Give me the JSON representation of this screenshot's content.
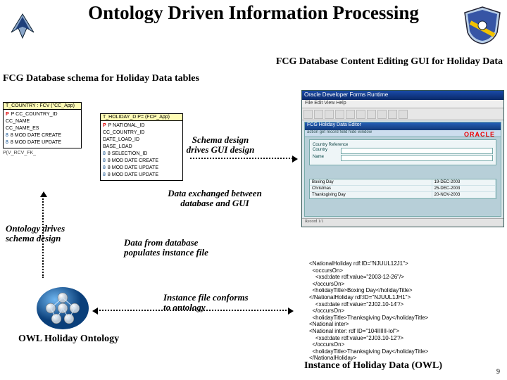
{
  "title": "Ontology Driven Information Processing",
  "labels": {
    "top_right": "FCG Database Content Editing GUI for Holiday Data",
    "top_left": "FCG Database schema for Holiday Data tables",
    "owl": "OWL Holiday Ontology",
    "bottom_right": "Instance of Holiday Data (OWL)"
  },
  "annotations": {
    "schema_to_gui": "Schema design\ndrives GUI design",
    "db_gui": "Data exchanged between\ndatabase and GUI",
    "ont_schema": "Ontology drives\nschema design",
    "db_to_instance": "Data from database\npopulates instance file",
    "instance_to_ont": "Instance file conforms\nto ontology"
  },
  "schema": {
    "table1": {
      "head": "T_COUNTRY : FCV (\"CC_App)",
      "rows": [
        "P  CC_COUNTRY_ID",
        "   CC_NAME",
        "   CC_NAME_ES",
        "8  MOD DATE CREATE",
        "8  MOD DATE UPDATE"
      ]
    },
    "table2": {
      "head": "T_HOLIDAY_D  P= (FCP_App)",
      "rows": [
        "P  NATIONAL_ID",
        "   CC_COUNTRY_ID",
        "   DATE_LOAD_ID",
        "   BASE_LOAD",
        "8  SELECTION_ID",
        "8  MOD DATE CREATE",
        "8  MOD DATE UPDATE",
        "8  MOD DATE UPDATE"
      ]
    },
    "rel": "P(V_RCV_FK_"
  },
  "gui": {
    "title": "Oracle Developer Forms Runtime",
    "menubar": "File  Edit  View  Help",
    "subbar": "FCG Holiday Data Editor",
    "menu2": "action  get  record  field  hide  window",
    "brand": "ORACLE",
    "form_caption": "Country Reference",
    "fields": [
      {
        "label": "Country",
        "value": ""
      },
      {
        "label": "Name",
        "value": ""
      }
    ],
    "rows": [
      {
        "c1": "Boxing Day",
        "c2": "19-DEC-2003"
      },
      {
        "c1": "Christmas",
        "c2": "25-DEC-2003"
      },
      {
        "c1": "Thanksgiving Day",
        "c2": "20-NOV-2003"
      }
    ],
    "status": "Record 1/1"
  },
  "xml_lines": [
    "<NationalHoliday rdf:ID=\"NJUUL12J1\">",
    "  <occursOn>",
    "    <xsd:date rdf:value=\"2003-12-26\"/>",
    "  </occursOn>",
    "  <holidayTitle>Boxing Day</holidayTitle>",
    "</NationalHoliday rdf:ID=\"NJUUL1JH1\">",
    "    <xsd:date rdf:value=\"2J02.10-14\"/>",
    "  </occursOn>",
    "  <holidayTitle>Thanksgiving Day</holidayTitle>",
    "<National inter>",
    "<National inter: rdf ID=\"اااااا104-lol\">",
    "    <xsd:date rdf:value=\"2J03.10-12\"/>",
    "  </occursOn>",
    "  <holidayTitle>Thanksgiving Day</holidayTitle>",
    "</NationalHoliday>"
  ],
  "slide_number": "9"
}
